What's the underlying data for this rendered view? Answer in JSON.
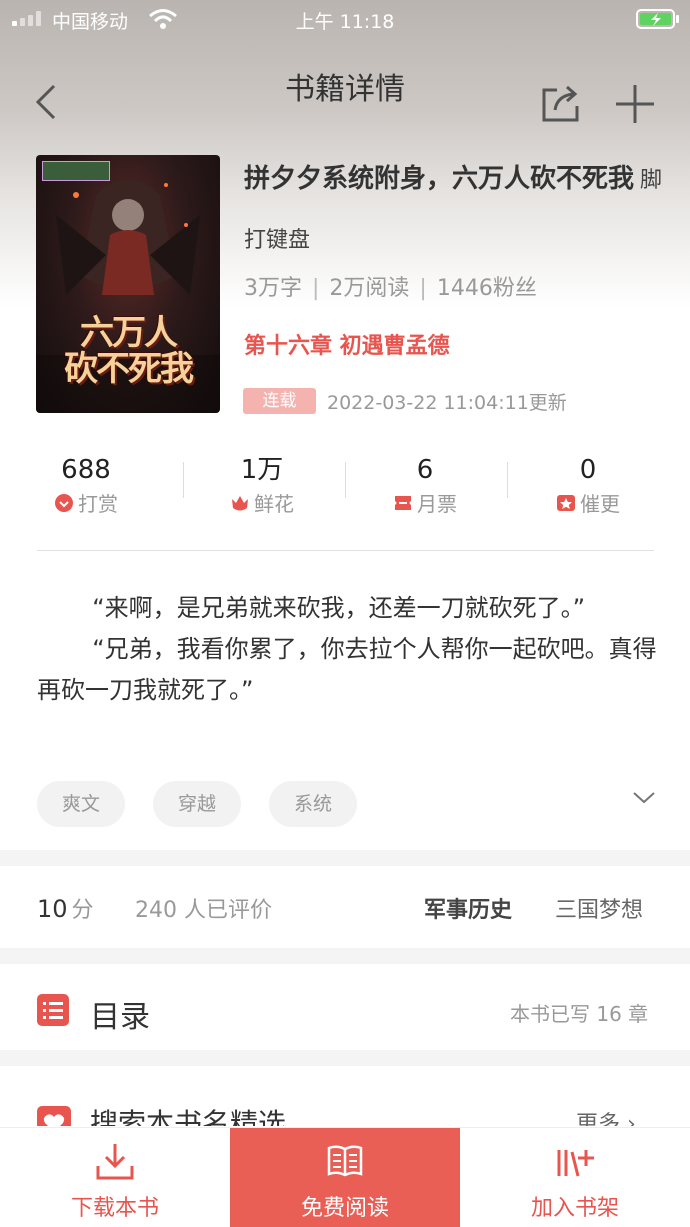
{
  "status_bar": {
    "carrier": "中国移动",
    "time": "上午 11:18"
  },
  "nav": {
    "title": "书籍详情"
  },
  "book": {
    "title": "拼夕夕系统附身，六万人砍不死我",
    "author": "脚打键盘",
    "word_count": "3万字",
    "reads": "2万阅读",
    "fans": "1446粉丝",
    "latest_chapter": "第十六章 初遇曹孟德",
    "status": "连载",
    "update_time": "2022-03-22 11:04:11更新",
    "cover_title_line1": "六万人",
    "cover_title_line2": "砍不死我"
  },
  "stats": [
    {
      "value": "688",
      "label": "打赏",
      "icon": "reward-icon",
      "color": "#e8554e"
    },
    {
      "value": "1万",
      "label": "鲜花",
      "icon": "flower-icon",
      "color": "#e8554e"
    },
    {
      "value": "6",
      "label": "月票",
      "icon": "ticket-icon",
      "color": "#e8554e"
    },
    {
      "value": "0",
      "label": "催更",
      "icon": "urge-icon",
      "color": "#e8554e"
    }
  ],
  "intro": {
    "p1": "“来啊，是兄弟就来砍我，还差一刀就砍死了。”",
    "p2": "“兄弟，我看你累了，你去拉个人帮你一起砍吧。真得再砍一刀我就死了。”"
  },
  "tags": [
    "爽文",
    "穿越",
    "系统"
  ],
  "rating": {
    "score": "10",
    "unit": "分",
    "reviews": "240 人已评价",
    "category": "军事历史",
    "subcategory": "三国梦想"
  },
  "toc": {
    "label": "目录",
    "count": "本书已写 16 章"
  },
  "search_section": {
    "label": "搜索本书名精选",
    "more": "更多 ›"
  },
  "bottom_bar": {
    "download": "下载本书",
    "read": "免费阅读",
    "shelf": "加入书架"
  },
  "colors": {
    "accent": "#e8554e",
    "read_button": "#e95f56"
  }
}
